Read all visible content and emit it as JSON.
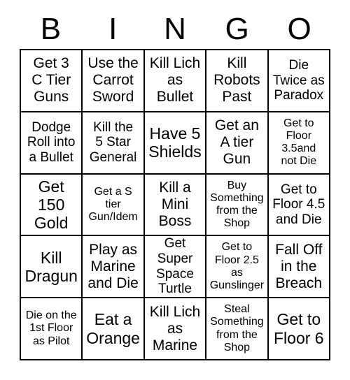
{
  "card": {
    "title": "BINGO",
    "header_letters": [
      "B",
      "I",
      "N",
      "G",
      "O"
    ],
    "grid": {
      "columns": 5,
      "rows": 5
    },
    "cells": [
      {
        "text": "Get 3\nC Tier\nGuns",
        "size": "lg"
      },
      {
        "text": "Use the\nCarrot\nSword",
        "size": "lg"
      },
      {
        "text": "Kill Lich\nas\nBullet",
        "size": "lg"
      },
      {
        "text": "Kill\nRobots\nPast",
        "size": "lg"
      },
      {
        "text": "Die\nTwice as\nParadox",
        "size": "md"
      },
      {
        "text": "Dodge\nRoll into\na Bullet",
        "size": "md"
      },
      {
        "text": "Kill the\n5 Star\nGeneral",
        "size": "md"
      },
      {
        "text": "Have 5\nShields",
        "size": "xl"
      },
      {
        "text": "Get an\nA tier\nGun",
        "size": "lg"
      },
      {
        "text": "Get to\nFloor\n3.5and\nnot Die",
        "size": "sm"
      },
      {
        "text": "Get\n150\nGold",
        "size": "xl"
      },
      {
        "text": "Get a S\ntier\nGun/Idem",
        "size": "sm"
      },
      {
        "text": "Kill a\nMini\nBoss",
        "size": "lg"
      },
      {
        "text": "Buy\nSomething\nfrom the\nShop",
        "size": "sm"
      },
      {
        "text": "Get to\nFloor 4.5\nand Die",
        "size": "md"
      },
      {
        "text": "Kill\nDragun",
        "size": "xl"
      },
      {
        "text": "Play as\nMarine\nand Die",
        "size": "lg"
      },
      {
        "text": "Get Super\nSpace\nTurtle",
        "size": "md"
      },
      {
        "text": "Get to\nFloor 2.5\nas\nGunslinger",
        "size": "sm"
      },
      {
        "text": "Fall Off\nin the\nBreach",
        "size": "lg"
      },
      {
        "text": "Die on the\n1st Floor\nas Pilot",
        "size": "sm"
      },
      {
        "text": "Eat a\nOrange",
        "size": "xl"
      },
      {
        "text": "Kill Lich\nas\nMarine",
        "size": "lg"
      },
      {
        "text": "Steal\nSomething\nfrom the\nShop",
        "size": "sm"
      },
      {
        "text": "Get to\nFloor 6",
        "size": "xl"
      }
    ]
  },
  "colors": {
    "background": "#ffffff",
    "border": "#000000",
    "text": "#000000"
  }
}
